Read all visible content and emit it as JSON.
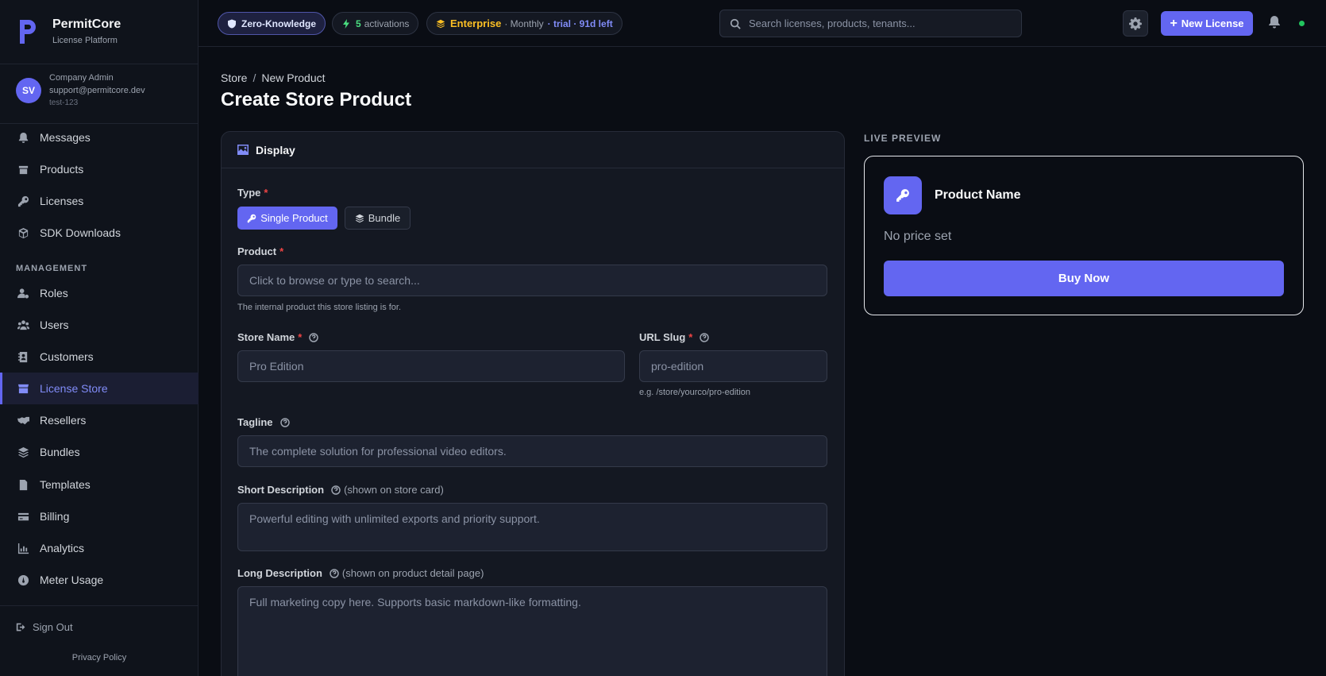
{
  "brand": {
    "name": "PermitCore",
    "subtitle": "License Platform"
  },
  "user": {
    "initials": "SV",
    "role": "Company Admin",
    "email": "support@permitcore.dev",
    "tenant": "test-123"
  },
  "nav": {
    "items": [
      {
        "label": "Messages",
        "icon": "bell-icon"
      },
      {
        "label": "Products",
        "icon": "box-icon"
      },
      {
        "label": "Licenses",
        "icon": "key-icon"
      },
      {
        "label": "SDK Downloads",
        "icon": "cube-icon"
      }
    ],
    "section_label": "MANAGEMENT",
    "management": [
      {
        "label": "Roles",
        "icon": "user-gear-icon"
      },
      {
        "label": "Users",
        "icon": "users-icon"
      },
      {
        "label": "Customers",
        "icon": "contact-book-icon"
      },
      {
        "label": "License Store",
        "icon": "store-icon",
        "active": true
      },
      {
        "label": "Resellers",
        "icon": "handshake-icon"
      },
      {
        "label": "Bundles",
        "icon": "layers-icon"
      },
      {
        "label": "Templates",
        "icon": "file-icon"
      },
      {
        "label": "Billing",
        "icon": "credit-card-icon"
      },
      {
        "label": "Analytics",
        "icon": "chart-icon"
      },
      {
        "label": "Meter Usage",
        "icon": "gauge-icon"
      }
    ],
    "sign_out": "Sign Out",
    "privacy": "Privacy Policy"
  },
  "topbar": {
    "zk_label": "Zero-Knowledge",
    "activations_count": "5",
    "activations_label": "activations",
    "plan_name": "Enterprise",
    "plan_period": "· Monthly",
    "plan_trial": "· trial · 91d left",
    "search_placeholder": "Search licenses, products, tenants...",
    "new_license_label": "New License"
  },
  "page": {
    "breadcrumb_root": "Store",
    "breadcrumb_sep": "/",
    "breadcrumb_current": "New Product",
    "title": "Create Store Product"
  },
  "form": {
    "section_title": "Display",
    "type_label": "Type",
    "type_options": [
      "Single Product",
      "Bundle"
    ],
    "product_label": "Product",
    "product_placeholder": "Click to browse or type to search...",
    "product_hint": "The internal product this store listing is for.",
    "store_name_label": "Store Name",
    "store_name_placeholder": "Pro Edition",
    "url_slug_label": "URL Slug",
    "url_slug_placeholder": "pro-edition",
    "url_slug_hint": "e.g. /store/yourco/pro-edition",
    "tagline_label": "Tagline",
    "tagline_placeholder": "The complete solution for professional video editors.",
    "short_desc_label": "Short Description",
    "short_desc_note": "(shown on store card)",
    "short_desc_placeholder": "Powerful editing with unlimited exports and priority support.",
    "long_desc_label": "Long Description",
    "long_desc_note": "(shown on product detail page)",
    "long_desc_placeholder": "Full marketing copy here. Supports basic markdown-like formatting.",
    "required_mark": "*"
  },
  "preview": {
    "heading": "LIVE PREVIEW",
    "product_name": "Product Name",
    "price": "No price set",
    "buy_label": "Buy Now"
  },
  "colors": {
    "accent": "#6366f1",
    "background": "#0a0d14",
    "panel": "#141822",
    "success": "#22c55e",
    "warning": "#fbbf24",
    "required": "#ef4444"
  }
}
